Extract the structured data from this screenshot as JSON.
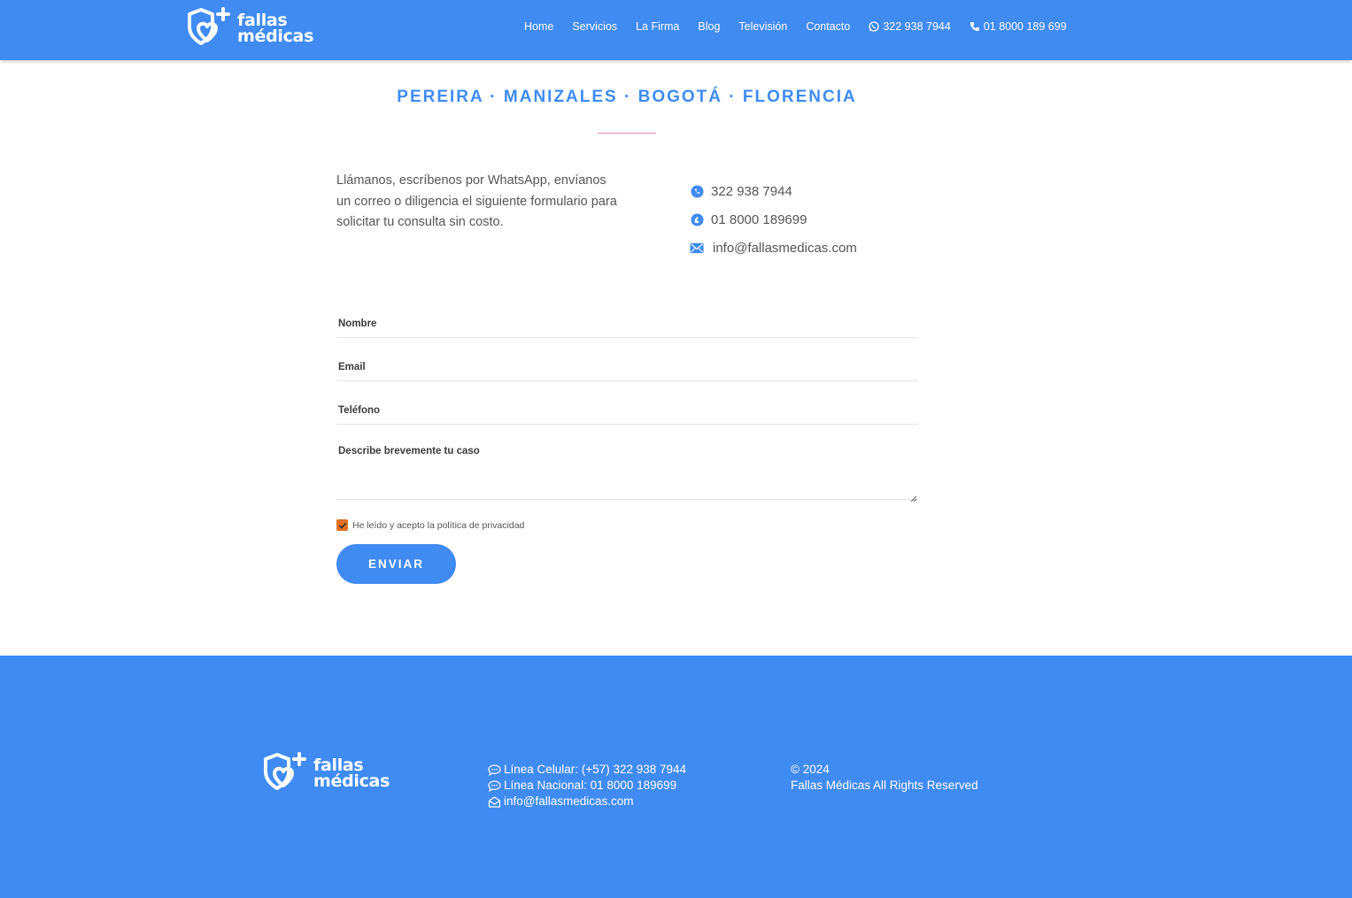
{
  "header": {
    "logo": {
      "line1": "fallas",
      "line2": "médicas",
      "icon": "heart-shield-plus-icon"
    },
    "nav": [
      {
        "label": "Home"
      },
      {
        "label": "Servicios"
      },
      {
        "label": "La Firma"
      },
      {
        "label": "Blog"
      },
      {
        "label": "Televisión"
      },
      {
        "label": "Contacto"
      },
      {
        "label": "322 938 7944",
        "icon": "whatsapp-icon"
      },
      {
        "label": "01 8000 189 699",
        "icon": "phone-icon"
      }
    ]
  },
  "main": {
    "cities": "PEREIRA · MANIZALES · BOGOTÁ · FLORENCIA",
    "intro": "Llámanos, escríbenos por WhatsApp, envíanos un correo o diligencia el siguiente formulario para solicitar tu consulta sin costo.",
    "contacts": [
      {
        "icon": "whatsapp-icon",
        "label": "322 938 7944"
      },
      {
        "icon": "phone-icon",
        "label": "01 8000 189699"
      },
      {
        "icon": "mail-icon",
        "label": "info@fallasmedicas.com"
      }
    ]
  },
  "form": {
    "name_label": "Nombre",
    "email_label": "Email",
    "phone_label": "Teléfono",
    "case_label": "Describe brevemente tu caso",
    "privacy_label": "He leído y acepto la política de privacidad",
    "privacy_checked": true,
    "submit_label": "ENVIAR"
  },
  "footer": {
    "logo": {
      "line1": "fallas",
      "line2": "médicas"
    },
    "contacts": [
      {
        "icon": "chat-icon",
        "label": "Línea Celular: (+57) 322 938 7944"
      },
      {
        "icon": "chat-icon",
        "label": "Línea Nacional: 01 8000 189699"
      },
      {
        "icon": "envelope-open-icon",
        "label": "info@fallasmedicas.com"
      }
    ],
    "copyright_year": "© 2024",
    "copyright_text": "Fallas Médicas All Rights Reserved"
  },
  "colors": {
    "brand_blue": "#3f8bf2",
    "divider_pink": "#e88ab4",
    "checkbox_orange": "#e07020"
  }
}
